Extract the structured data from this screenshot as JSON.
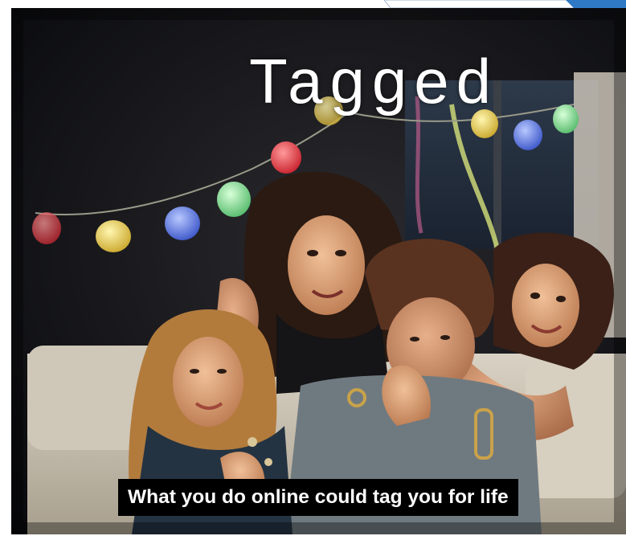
{
  "slide": {
    "title": "Tagged",
    "caption": "What you do online could tag you for life",
    "photo_description_icon": "group-of-teens-photo"
  },
  "colors": {
    "accent_blue": "#2f78c4",
    "caption_bg": "#000000",
    "text": "#ffffff"
  }
}
